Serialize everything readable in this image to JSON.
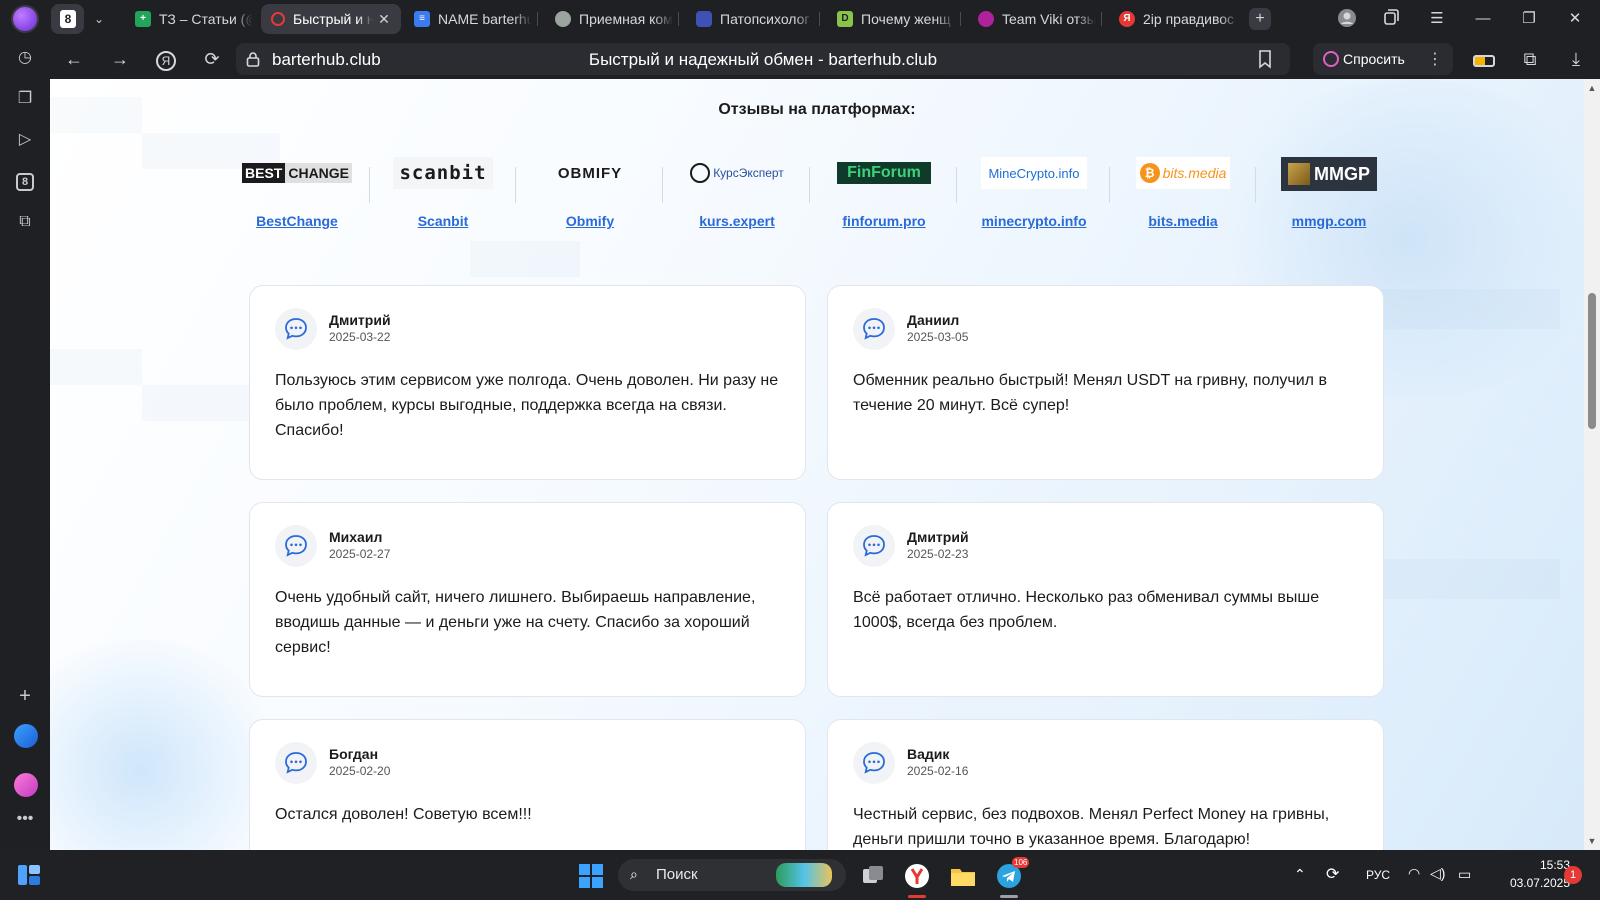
{
  "browser": {
    "tab_counter": "8",
    "tabs": [
      {
        "label": "ТЗ – Статьи (@",
        "fav_color": "#22a55b",
        "fav_glyph": "+"
      },
      {
        "label": "Быстрый и над",
        "fav_color": "#e53935",
        "fav_glyph": "",
        "active": true
      },
      {
        "label": "NAME barterhub",
        "fav_color": "#3b7bf0",
        "fav_glyph": "≡"
      },
      {
        "label": "Приемная ком",
        "fav_color": "#9aa5a0",
        "fav_glyph": ""
      },
      {
        "label": "Патопсихолог",
        "fav_color": "#3f51b5",
        "fav_glyph": ""
      },
      {
        "label": "Почему женщ",
        "fav_color": "#8bc34a",
        "fav_glyph": "D"
      },
      {
        "label": "Team Viki отзы",
        "fav_color": "#b0229c",
        "fav_glyph": ""
      },
      {
        "label": "2ip правдивос",
        "fav_color": "#e53935",
        "fav_glyph": "Я"
      }
    ],
    "address": {
      "domain": "barterhub.club",
      "page_title": "Быстрый и надежный обмен - barterhub.club"
    },
    "ask_label": "Спросить",
    "sidebar_badge": "8"
  },
  "page": {
    "section_title": "Отзывы на платформах:",
    "platforms": [
      {
        "name": "BestChange",
        "logo_text": "BEST CHANGE"
      },
      {
        "name": "Scanbit",
        "logo_text": "scanbit"
      },
      {
        "name": "Obmify",
        "logo_text": "OBMIFY"
      },
      {
        "name": "kurs.expert",
        "logo_text": "КурсЭксперт"
      },
      {
        "name": "finforum.pro",
        "logo_text": "FinForum"
      },
      {
        "name": "minecrypto.info",
        "logo_text": "MineCrypto.info"
      },
      {
        "name": "bits.media",
        "logo_text": "bits.media"
      },
      {
        "name": "mmgp.com",
        "logo_text": "MMGP"
      }
    ],
    "reviews": [
      {
        "author": "Дмитрий",
        "date": "2025-03-22",
        "text": "Пользуюсь этим сервисом уже полгода. Очень доволен. Ни разу не было проблем, курсы выгодные, поддержка всегда на связи. Спасибо!"
      },
      {
        "author": "Даниил",
        "date": "2025-03-05",
        "text": "Обменник реально быстрый! Менял USDT на гривну, получил в течение 20 минут. Всё супер!"
      },
      {
        "author": "Михаил",
        "date": "2025-02-27",
        "text": "Очень удобный сайт, ничего лишнего. Выбираешь направление, вводишь данные — и деньги уже на счету. Спасибо за хороший сервис!"
      },
      {
        "author": "Дмитрий",
        "date": "2025-02-23",
        "text": "Всё работает отлично. Несколько раз обменивал суммы выше 1000$, всегда без проблем."
      },
      {
        "author": "Богдан",
        "date": "2025-02-20",
        "text": "Остался доволен! Советую всем!!!"
      },
      {
        "author": "Вадик",
        "date": "2025-02-16",
        "text": "Честный сервис, без подвохов. Менял Perfect Money на гривны, деньги пришли точно в указанное время. Благодарю!"
      }
    ]
  },
  "taskbar": {
    "search_label": "Поиск",
    "telegram_badge": "106",
    "language": "РУС",
    "time": "15:53",
    "date": "03.07.2025",
    "notification_count": "1"
  },
  "colors": {
    "link": "#2a6bd8",
    "accent_icon": "#2a6bd8",
    "chrome_bg": "#1f2024"
  }
}
